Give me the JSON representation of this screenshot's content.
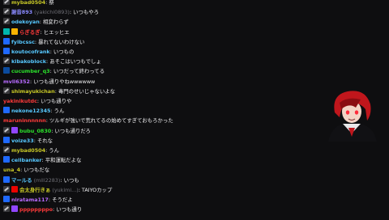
{
  "chat": [
    {
      "user": "mybad0504",
      "color": "#c8c827",
      "badges": [
        "sword"
      ],
      "text": "祭"
    },
    {
      "user": "謝音893",
      "display_extra": "(yakichi0893)",
      "color": "#8a8aff",
      "badges": [
        "sword"
      ],
      "text": "いつもやろ"
    },
    {
      "user": "odekoyan",
      "color": "#57c8ff",
      "badges": [
        "sword"
      ],
      "text": "相変わらず"
    },
    {
      "user": "らぎるぎ",
      "display_extra": "",
      "color": "#ff3a3a",
      "badges": [
        "cyan",
        "star"
      ],
      "text": "ヒエッヒエ"
    },
    {
      "user": "fyibcssc",
      "color": "#57c8ff",
      "badges": [
        "blue"
      ],
      "text": "暴れてないわけない"
    },
    {
      "user": "koutocofrank",
      "color": "#57c8ff",
      "badges": [
        "blue"
      ],
      "text": "いつもの"
    },
    {
      "user": "kibakoblock",
      "color": "#57c8ff",
      "badges": [
        "sword"
      ],
      "text": "あそこはいつもでしょ"
    },
    {
      "user": "cucumber_q3",
      "color": "#2be02b",
      "badges": [
        "prime"
      ],
      "text": "いつだって終わってる"
    },
    {
      "user": "mvll6352",
      "color": "#b86bff",
      "badges": [],
      "text": "いつも通りやねwwwwww"
    },
    {
      "user": "shimayukichan",
      "color": "#c8c827",
      "badges": [
        "sword"
      ],
      "text": "毒門のせいじゃないよな"
    },
    {
      "user": "yakinikutdc",
      "color": "#ff3a3a",
      "badges": [],
      "text": "いつも通りや"
    },
    {
      "user": "nekone12345",
      "color": "#57c8ff",
      "badges": [
        "blue"
      ],
      "text": "うん"
    },
    {
      "user": "maruninnnnnn",
      "color": "#ff3a3a",
      "badges": [],
      "text": "ツルギが強いで荒れてるの始めてすぎておもろかった"
    },
    {
      "user": "bubu_0830",
      "color": "#2be02b",
      "badges": [
        "sword",
        "purple"
      ],
      "text": "いつも通りだろ"
    },
    {
      "user": "voize33",
      "color": "#57c8ff",
      "badges": [
        "blue"
      ],
      "text": "それな"
    },
    {
      "user": "mybad0504",
      "color": "#c8c827",
      "badges": [
        "sword"
      ],
      "text": "うん"
    },
    {
      "user": "cellbanker",
      "color": "#57c8ff",
      "badges": [
        "blue"
      ],
      "text": "平和運転だよな"
    },
    {
      "user": "una_4",
      "color": "#c8c827",
      "badges": [],
      "text": "いつもだな"
    },
    {
      "user": "マールる",
      "display_extra": "(mill2283)",
      "color": "#57c8ff",
      "badges": [
        "blue"
      ],
      "text": "いつも"
    },
    {
      "user": "会太身行きぁ",
      "display_extra": "(yukimi...)",
      "color": "#c8c827",
      "badges": [
        "sword",
        "red"
      ],
      "text": "TAIYOカップ"
    },
    {
      "user": "niratama117",
      "color": "#b86bff",
      "badges": [
        "blue"
      ],
      "text": "そうだよ"
    },
    {
      "user": "ppppppppo",
      "color": "#ff3a3a",
      "badges": [
        "sword",
        "purple"
      ],
      "text": "いつも通り"
    }
  ],
  "avatar": {
    "hair_color": "#c0161c",
    "skin_color": "#f3d3c5",
    "coat_color": "#111114",
    "eye_color": "#ff2a3a"
  }
}
